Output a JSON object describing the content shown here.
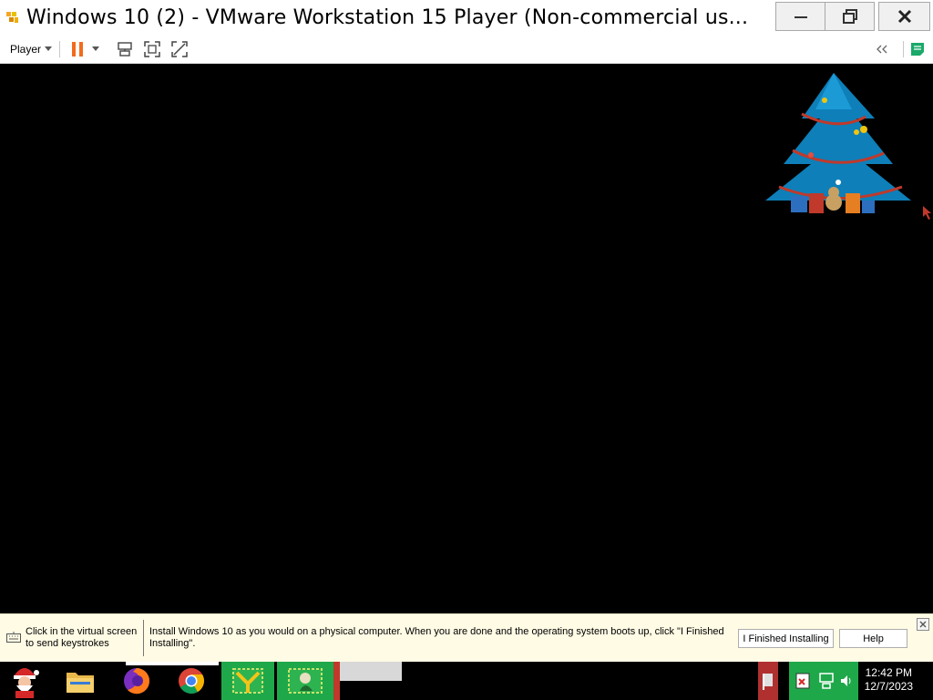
{
  "window": {
    "title": "Windows 10 (2) - VMware Workstation 15 Player (Non-commercial us...",
    "icon": "vmware-icon"
  },
  "toolbar": {
    "player_menu_label": "Player",
    "icons": [
      "pause-icon",
      "dropdown-icon",
      "send-ctrl-alt-del-icon",
      "fullscreen-icon",
      "unity-icon",
      "collapse-icon",
      "notes-icon"
    ]
  },
  "hint": {
    "left_text": "Click in the virtual screen to send keystrokes",
    "main_text": "Install Windows 10 as you would on a physical computer. When you are done and the operating system boots up, click \"I Finished Installing\".",
    "finished_button": "I Finished Installing",
    "help_button": "Help"
  },
  "taskbar": {
    "apps": [
      "santa-start-icon",
      "file-explorer-icon",
      "firefox-icon",
      "chrome-icon",
      "app-icon-green-1",
      "app-icon-green-2"
    ],
    "time": "12:42 PM",
    "date": "12/7/2023"
  },
  "colors": {
    "pause_orange": "#f26b1d",
    "hint_bg": "#fffbe5",
    "notes_green": "#1aa96a"
  }
}
